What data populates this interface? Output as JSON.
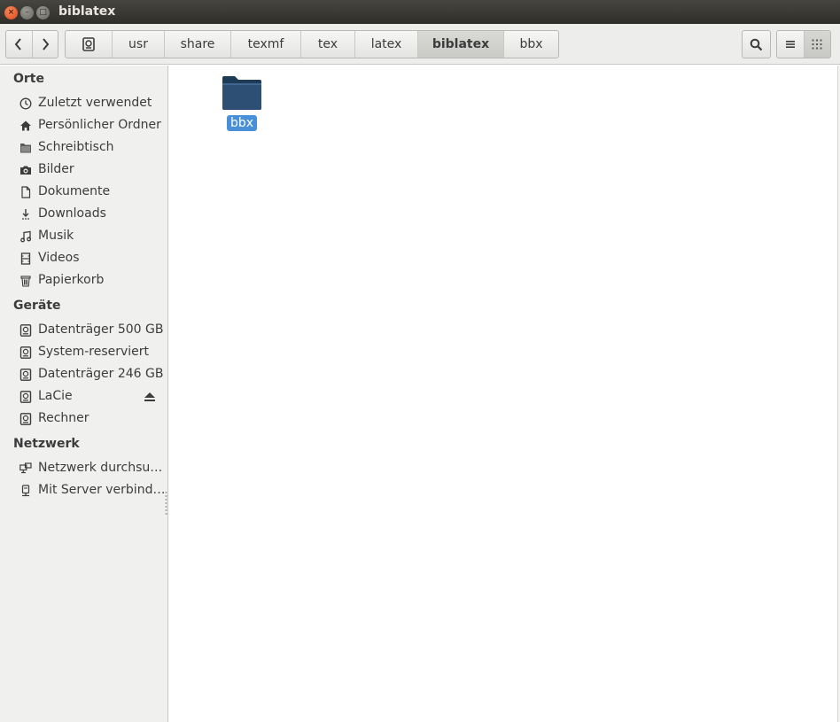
{
  "window": {
    "title": "biblatex",
    "close_glyph": "×",
    "min_glyph": "–",
    "max_glyph": "□"
  },
  "toolbar": {
    "back_glyph": "‹",
    "forward_glyph": "›",
    "breadcrumbs": [
      {
        "label": "usr"
      },
      {
        "label": "share"
      },
      {
        "label": "texmf"
      },
      {
        "label": "tex"
      },
      {
        "label": "latex"
      },
      {
        "label": "biblatex",
        "active": true
      },
      {
        "label": "bbx"
      }
    ]
  },
  "sidebar": {
    "places_heading": "Orte",
    "places": [
      {
        "label": "Zuletzt verwendet",
        "icon": "clock-icon"
      },
      {
        "label": "Persönlicher Ordner",
        "icon": "home-icon"
      },
      {
        "label": "Schreibtisch",
        "icon": "desktop-folder-icon"
      },
      {
        "label": "Bilder",
        "icon": "camera-icon"
      },
      {
        "label": "Dokumente",
        "icon": "document-icon"
      },
      {
        "label": "Downloads",
        "icon": "download-icon"
      },
      {
        "label": "Musik",
        "icon": "music-icon"
      },
      {
        "label": "Videos",
        "icon": "film-icon"
      },
      {
        "label": "Papierkorb",
        "icon": "trash-icon"
      }
    ],
    "devices_heading": "Geräte",
    "devices": [
      {
        "label": "Datenträger 500 GB",
        "icon": "drive-icon"
      },
      {
        "label": "System-reserviert",
        "icon": "drive-icon"
      },
      {
        "label": "Datenträger 246 GB",
        "icon": "drive-icon"
      },
      {
        "label": "LaCie",
        "icon": "drive-icon",
        "eject": true
      },
      {
        "label": "Rechner",
        "icon": "drive-icon"
      }
    ],
    "network_heading": "Netzwerk",
    "network": [
      {
        "label": "Netzwerk durchsu…",
        "icon": "network-icon"
      },
      {
        "label": "Mit Server verbind…",
        "icon": "server-icon"
      }
    ]
  },
  "content": {
    "files": [
      {
        "name": "bbx",
        "type": "folder",
        "selected": true
      }
    ]
  },
  "colors": {
    "selection": "#4a90d9",
    "folder": "#2c4f73",
    "titlebar": "#3a3a37"
  }
}
